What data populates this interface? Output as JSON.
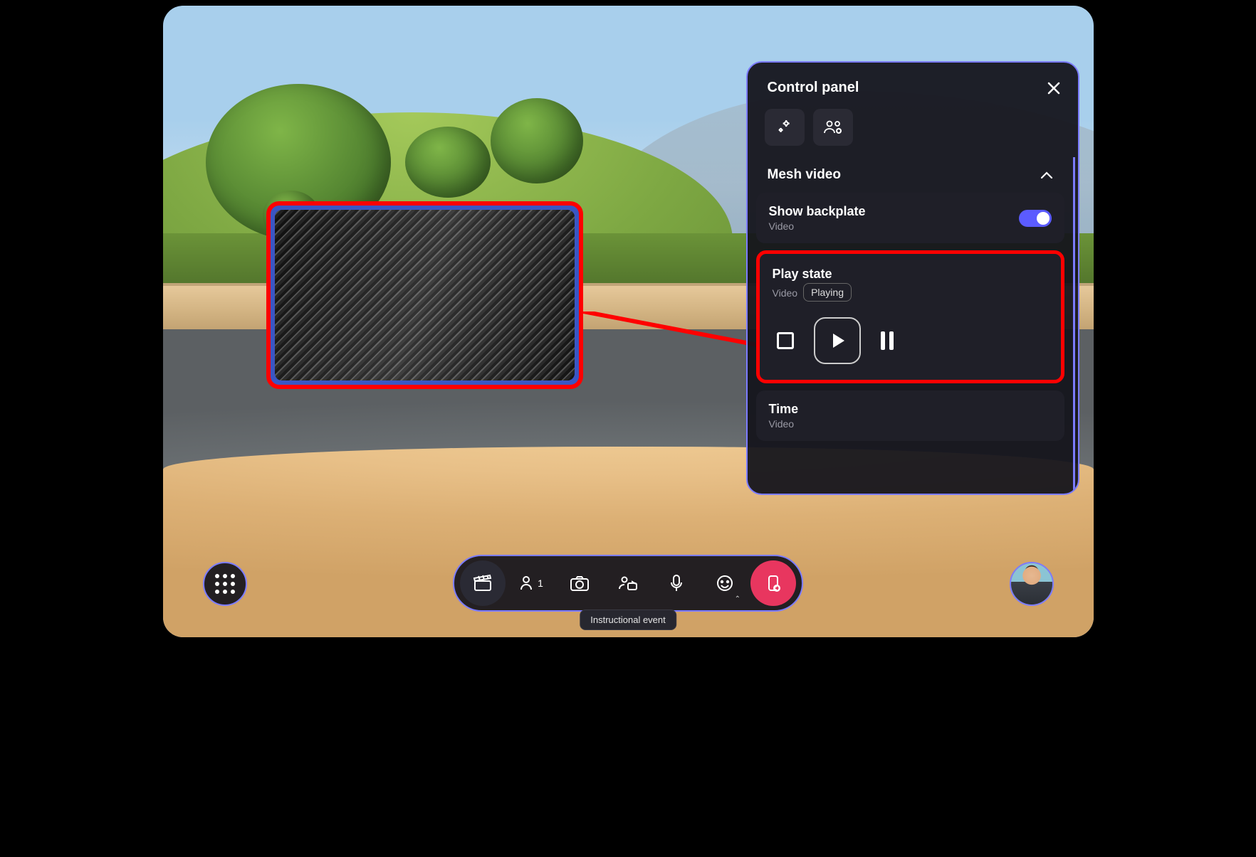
{
  "panel": {
    "title": "Control panel",
    "section_title": "Mesh video",
    "backplate": {
      "title": "Show backplate",
      "sub": "Video",
      "on": true
    },
    "playstate": {
      "title": "Play state",
      "sub": "Video",
      "badge": "Playing"
    },
    "time": {
      "title": "Time",
      "sub": "Video"
    }
  },
  "toolbar": {
    "people_count": "1"
  },
  "tooltip": "Instructional event"
}
